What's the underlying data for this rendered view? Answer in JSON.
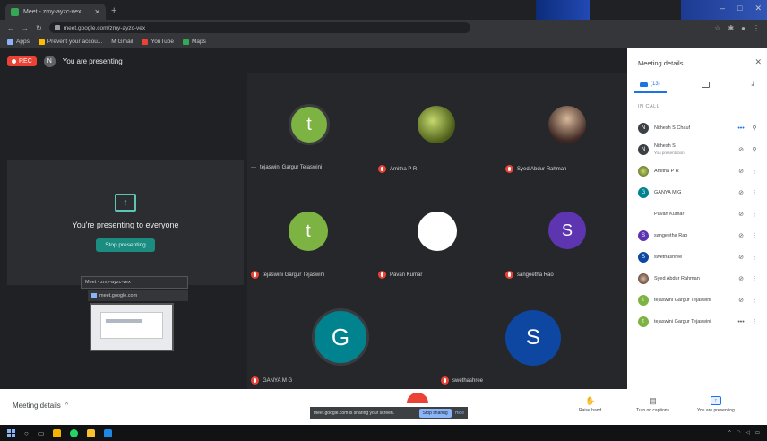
{
  "browser": {
    "tab_title": "Meet - zmy-ayzc-vex",
    "url": "meet.google.com/zmy-ayzc-vex",
    "bookmarks": [
      "Apps",
      "Prevent your accou...",
      "M Gmail",
      "YouTube",
      "Maps"
    ]
  },
  "meet": {
    "rec_badge": "REC",
    "presenter_initial": "N",
    "presenting_text": "You are presenting",
    "presenting_panel_title": "You're presenting to everyone",
    "stop_button": "Stop presenting",
    "tiles": [
      {
        "initial": "t",
        "name": "tejaswini Gargur Tejaswini",
        "color": "#7cb342"
      },
      {
        "initial": "",
        "name": "Amitha P R",
        "color": "#6b7a2a"
      },
      {
        "initial": "",
        "name": "Syed Abdur Rahman",
        "color": "#8d6e63"
      },
      {
        "initial": "t",
        "name": "tejaswini Gargur Tejaswini",
        "color": "#7cb342"
      },
      {
        "initial": "",
        "name": "Pavan Kumar",
        "color": "#ffffff"
      },
      {
        "initial": "S",
        "name": "sangeetha Rao",
        "color": "#5e35b1"
      },
      {
        "initial": "G",
        "name": "GANYA M G",
        "color": "#00838f"
      },
      {
        "initial": "S",
        "name": "swethashree",
        "color": "#0d47a1"
      }
    ],
    "thumbnail_text": "Meet - zmy-ayzc-vex",
    "thumbnail_text2": "meet.google.com"
  },
  "side_panel": {
    "title": "Meeting details",
    "people_count": "(13)",
    "section_label": "IN CALL",
    "people": [
      {
        "initial": "N",
        "name": "Nithesh S Chauf",
        "sub": "",
        "color": "#3c4043"
      },
      {
        "initial": "N",
        "name": "Nithesh S",
        "sub": "You presentation",
        "color": "#3c4043"
      },
      {
        "initial": "",
        "name": "Amitha P R",
        "sub": "",
        "color": "#6b7a2a"
      },
      {
        "initial": "G",
        "name": "GANYA M G",
        "sub": "",
        "color": "#00838f"
      },
      {
        "initial": "",
        "name": "Pavan Kumar",
        "sub": "",
        "color": "#ffffff"
      },
      {
        "initial": "S",
        "name": "sangeetha Rao",
        "sub": "",
        "color": "#5e35b1"
      },
      {
        "initial": "S",
        "name": "swethashree",
        "sub": "",
        "color": "#0d47a1"
      },
      {
        "initial": "",
        "name": "Syed Abdur Rahman",
        "sub": "",
        "color": "#8d6e63"
      },
      {
        "initial": "t",
        "name": "tejaswini Gargur Tejaswini",
        "sub": "",
        "color": "#7cb342"
      },
      {
        "initial": "t",
        "name": "tejaswini Gargur Tejaswini",
        "sub": "",
        "color": "#7cb342"
      }
    ]
  },
  "bottom": {
    "meeting_details": "Meeting details",
    "share_text": "meet.google.com is sharing your screen.",
    "stop_sharing": "Stop sharing",
    "hide": "Hide",
    "raise_hand": "Raise hand",
    "captions": "Turn on captions",
    "presenting": "You are presenting"
  }
}
